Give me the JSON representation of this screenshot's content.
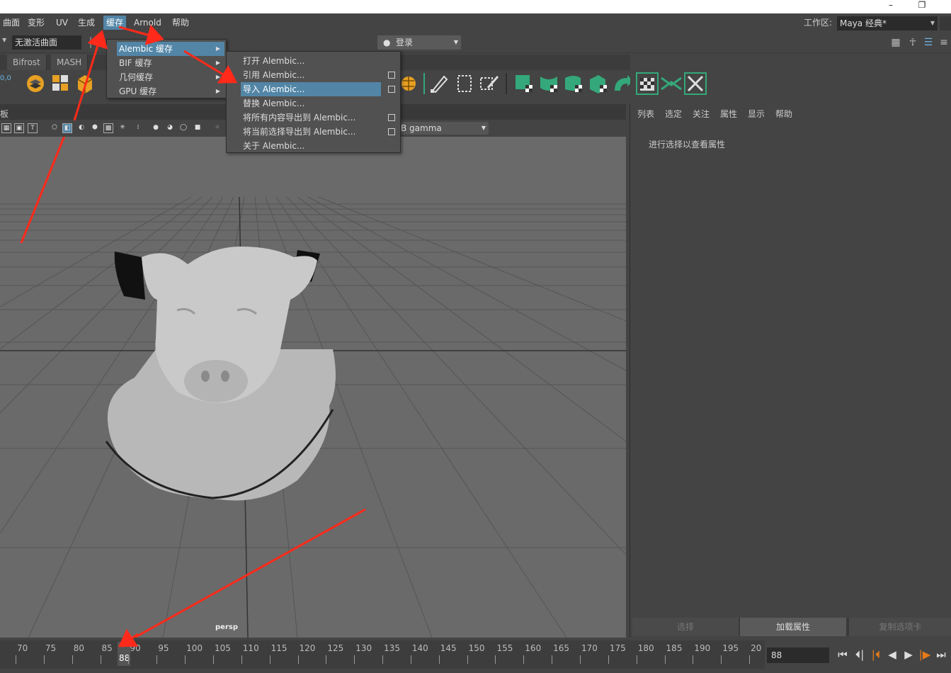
{
  "window": {
    "minimize_glyph": "–",
    "restore_glyph": "❐"
  },
  "menubar": {
    "items": [
      "曲面",
      "变形",
      "UV",
      "生成",
      "缓存",
      "Arnold",
      "帮助"
    ],
    "workspace_label": "工作区:",
    "workspace_value": "Maya 经典*"
  },
  "statusline": {
    "mode_value": "无激活曲面",
    "login_value": "登录"
  },
  "shelf_tabs": [
    "Bifrost",
    "MASH"
  ],
  "cache_menu": {
    "items": [
      "Alembic 缓存",
      "BIF 缓存",
      "几何缓存",
      "GPU 缓存"
    ]
  },
  "alembic_menu": {
    "items": [
      "打开 Alembic...",
      "引用 Alembic...",
      "导入 Alembic...",
      "替换 Alembic...",
      "将所有内容导出到 Alembic...",
      "将当前选择导出到 Alembic...",
      "关于 Alembic..."
    ]
  },
  "viewport": {
    "panel_label": "板",
    "gamma_value": "B gamma",
    "camera_label": "persp"
  },
  "attr_editor": {
    "menu": [
      "列表",
      "选定",
      "关注",
      "属性",
      "显示",
      "帮助"
    ],
    "hint": "进行选择以查看属性",
    "buttons": [
      "选择",
      "加载属性",
      "复制选项卡"
    ]
  },
  "timeline": {
    "tick_labels": [
      "70",
      "75",
      "80",
      "85",
      "90",
      "95",
      "100",
      "105",
      "110",
      "115",
      "120",
      "125",
      "130",
      "135",
      "140",
      "145",
      "150",
      "155",
      "160",
      "165",
      "170",
      "175",
      "180",
      "185",
      "190",
      "195",
      "20"
    ],
    "current_frame": "88",
    "frame_field": "88",
    "playback": [
      "⏮",
      "⏴|",
      "|⏴",
      "◀",
      "▶",
      "|▶",
      "⏭"
    ]
  },
  "left_readout": "0,0",
  "colors": {
    "accent": "#5285a6",
    "arrow": "#ff2a1a",
    "shelf_green": "#34a87a",
    "highlight_orange": "#e6a024"
  }
}
